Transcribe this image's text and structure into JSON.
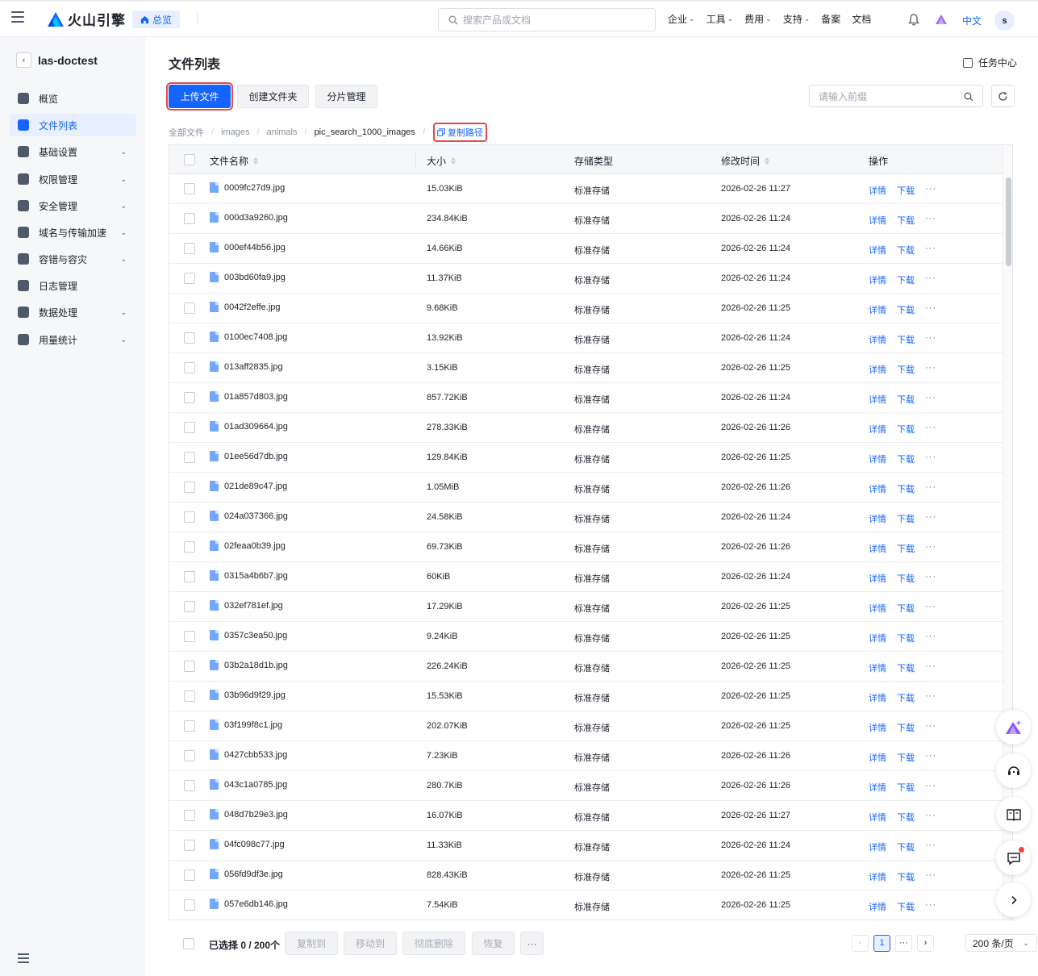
{
  "topbar": {
    "brand": "火山引擎",
    "home_label": "总览",
    "search_placeholder": "搜索产品或文档",
    "nav": [
      {
        "label": "企业",
        "has_menu": true
      },
      {
        "label": "工具",
        "has_menu": true
      },
      {
        "label": "费用",
        "has_menu": true
      },
      {
        "label": "支持",
        "has_menu": true
      },
      {
        "label": "备案",
        "has_menu": false
      },
      {
        "label": "文档",
        "has_menu": false
      }
    ],
    "language": "中文",
    "avatar_letter": "s"
  },
  "sidebar": {
    "title": "las-doctest",
    "items": [
      {
        "label": "概览",
        "icon": "overview-icon",
        "expandable": false,
        "active": false
      },
      {
        "label": "文件列表",
        "icon": "file-list-icon",
        "expandable": false,
        "active": true
      },
      {
        "label": "基础设置",
        "icon": "settings-icon",
        "expandable": true,
        "active": false
      },
      {
        "label": "权限管理",
        "icon": "permission-icon",
        "expandable": true,
        "active": false
      },
      {
        "label": "安全管理",
        "icon": "shield-icon",
        "expandable": true,
        "active": false
      },
      {
        "label": "域名与传输加速",
        "icon": "domain-icon",
        "expandable": true,
        "active": false
      },
      {
        "label": "容错与容灾",
        "icon": "disaster-recovery-icon",
        "expandable": true,
        "active": false
      },
      {
        "label": "日志管理",
        "icon": "log-icon",
        "expandable": false,
        "active": false
      },
      {
        "label": "数据处理",
        "icon": "data-processing-icon",
        "expandable": true,
        "active": false
      },
      {
        "label": "用量统计",
        "icon": "usage-icon",
        "expandable": true,
        "active": false
      }
    ]
  },
  "main": {
    "title": "文件列表",
    "task_center": "任务中心",
    "buttons": {
      "upload": "上传文件",
      "create_folder": "创建文件夹",
      "multipart": "分片管理"
    },
    "prefix_placeholder": "请输入前缀",
    "breadcrumb": [
      "全部文件",
      "images",
      "animals",
      "pic_search_1000_images"
    ],
    "copy_path": "复制路径",
    "columns": {
      "name": "文件名称",
      "size": "大小",
      "storage": "存储类型",
      "modified": "修改时间",
      "ops": "操作"
    },
    "row_actions": {
      "detail": "详情",
      "download": "下载",
      "more": "···"
    },
    "rows": [
      {
        "name": "0009fc27d9.jpg",
        "size": "15.03KiB",
        "storage": "标准存储",
        "modified": "2026-02-26 11:27"
      },
      {
        "name": "000d3a9260.jpg",
        "size": "234.84KiB",
        "storage": "标准存储",
        "modified": "2026-02-26 11:24"
      },
      {
        "name": "000ef44b56.jpg",
        "size": "14.66KiB",
        "storage": "标准存储",
        "modified": "2026-02-26 11:24"
      },
      {
        "name": "003bd60fa9.jpg",
        "size": "11.37KiB",
        "storage": "标准存储",
        "modified": "2026-02-26 11:24"
      },
      {
        "name": "0042f2effe.jpg",
        "size": "9.68KiB",
        "storage": "标准存储",
        "modified": "2026-02-26 11:25"
      },
      {
        "name": "0100ec7408.jpg",
        "size": "13.92KiB",
        "storage": "标准存储",
        "modified": "2026-02-26 11:24"
      },
      {
        "name": "013aff2835.jpg",
        "size": "3.15KiB",
        "storage": "标准存储",
        "modified": "2026-02-26 11:25"
      },
      {
        "name": "01a857d803.jpg",
        "size": "857.72KiB",
        "storage": "标准存储",
        "modified": "2026-02-26 11:24"
      },
      {
        "name": "01ad309664.jpg",
        "size": "278.33KiB",
        "storage": "标准存储",
        "modified": "2026-02-26 11:26"
      },
      {
        "name": "01ee56d7db.jpg",
        "size": "129.84KiB",
        "storage": "标准存储",
        "modified": "2026-02-26 11:25"
      },
      {
        "name": "021de89c47.jpg",
        "size": "1.05MiB",
        "storage": "标准存储",
        "modified": "2026-02-26 11:26"
      },
      {
        "name": "024a037366.jpg",
        "size": "24.58KiB",
        "storage": "标准存储",
        "modified": "2026-02-26 11:24"
      },
      {
        "name": "02feaa0b39.jpg",
        "size": "69.73KiB",
        "storage": "标准存储",
        "modified": "2026-02-26 11:26"
      },
      {
        "name": "0315a4b6b7.jpg",
        "size": "60KiB",
        "storage": "标准存储",
        "modified": "2026-02-26 11:24"
      },
      {
        "name": "032ef781ef.jpg",
        "size": "17.29KiB",
        "storage": "标准存储",
        "modified": "2026-02-26 11:25"
      },
      {
        "name": "0357c3ea50.jpg",
        "size": "9.24KiB",
        "storage": "标准存储",
        "modified": "2026-02-26 11:25"
      },
      {
        "name": "03b2a18d1b.jpg",
        "size": "226.24KiB",
        "storage": "标准存储",
        "modified": "2026-02-26 11:25"
      },
      {
        "name": "03b96d9f29.jpg",
        "size": "15.53KiB",
        "storage": "标准存储",
        "modified": "2026-02-26 11:25"
      },
      {
        "name": "03f199f8c1.jpg",
        "size": "202.07KiB",
        "storage": "标准存储",
        "modified": "2026-02-26 11:25"
      },
      {
        "name": "0427cbb533.jpg",
        "size": "7.23KiB",
        "storage": "标准存储",
        "modified": "2026-02-26 11:26"
      },
      {
        "name": "043c1a0785.jpg",
        "size": "280.7KiB",
        "storage": "标准存储",
        "modified": "2026-02-26 11:26"
      },
      {
        "name": "048d7b29e3.jpg",
        "size": "16.07KiB",
        "storage": "标准存储",
        "modified": "2026-02-26 11:27"
      },
      {
        "name": "04fc098c77.jpg",
        "size": "11.33KiB",
        "storage": "标准存储",
        "modified": "2026-02-26 11:24"
      },
      {
        "name": "056fd9df3e.jpg",
        "size": "828.43KiB",
        "storage": "标准存储",
        "modified": "2026-02-26 11:25"
      },
      {
        "name": "057e6db146.jpg",
        "size": "7.54KiB",
        "storage": "标准存储",
        "modified": "2026-02-26 11:25"
      }
    ],
    "footer": {
      "selected": "已选择 0 / 200个",
      "copy_to": "复制到",
      "move_to": "移动到",
      "delete": "彻底删除",
      "restore": "恢复",
      "more": "···",
      "current_page": "1",
      "ellipsis": "···",
      "per_page": "200 条/页"
    }
  },
  "colors": {
    "primary": "#1664ff",
    "highlight_outline": "#e5484d"
  }
}
